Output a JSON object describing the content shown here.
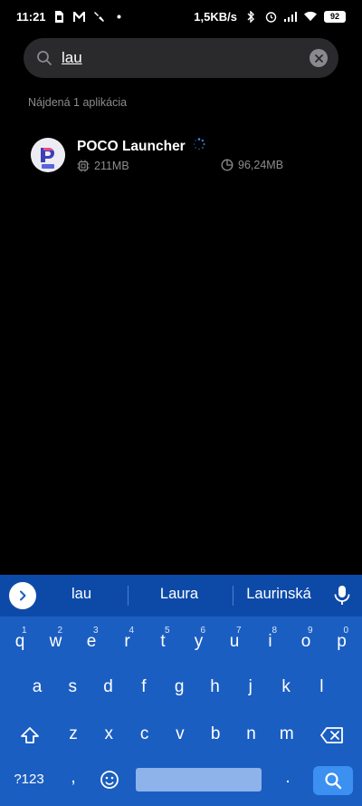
{
  "status_bar": {
    "time": "11:21",
    "net_speed": "1,5KB/s",
    "battery": "92"
  },
  "search": {
    "query": "lau"
  },
  "results": {
    "count_label": "Nájdená 1 aplikácia",
    "apps": [
      {
        "name": "POCO Launcher",
        "size": "211MB",
        "cache_size": "96,24MB"
      }
    ]
  },
  "keyboard": {
    "suggestions": [
      "lau",
      "Laura",
      "Laurinská"
    ],
    "row1": [
      "q",
      "w",
      "e",
      "r",
      "t",
      "y",
      "u",
      "i",
      "o",
      "p"
    ],
    "row1_hints": [
      "1",
      "2",
      "3",
      "4",
      "5",
      "6",
      "7",
      "8",
      "9",
      "0"
    ],
    "row2": [
      "a",
      "s",
      "d",
      "f",
      "g",
      "h",
      "j",
      "k",
      "l"
    ],
    "row3": [
      "z",
      "x",
      "c",
      "v",
      "b",
      "n",
      "m"
    ],
    "symbols_label": "?123",
    "comma": ",",
    "period": "."
  },
  "colors": {
    "keyboard_bg": "#1b5ec2",
    "suggest_bg": "#0d4aa8",
    "accent": "#3b90f2"
  }
}
